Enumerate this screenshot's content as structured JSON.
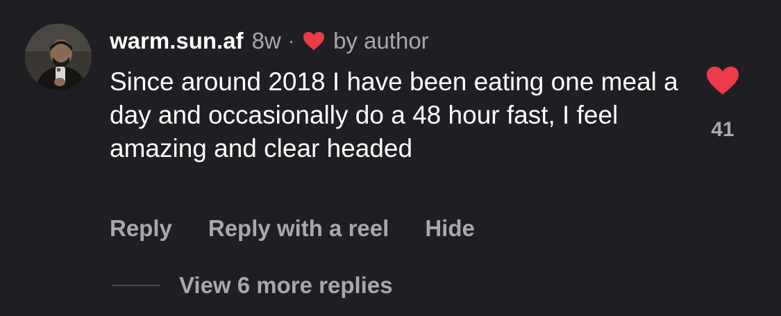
{
  "comment": {
    "username": "warm.sun.af",
    "time": "8w",
    "separator": "·",
    "author_like": "by author",
    "text": "Since around 2018 I have been eating one meal a day and occasionally do a 48 hour fast, I feel amazing and clear headed",
    "like_count": "41",
    "liked": true,
    "like_icon": "heart-filled"
  },
  "actions": {
    "reply": "Reply",
    "reply_with_reel": "Reply with a reel",
    "hide": "Hide"
  },
  "replies": {
    "view_more": "View 6 more replies"
  },
  "colors": {
    "background": "#1f1f23",
    "heart": "#ed3b4a",
    "muted_text": "#a8a8ad"
  }
}
